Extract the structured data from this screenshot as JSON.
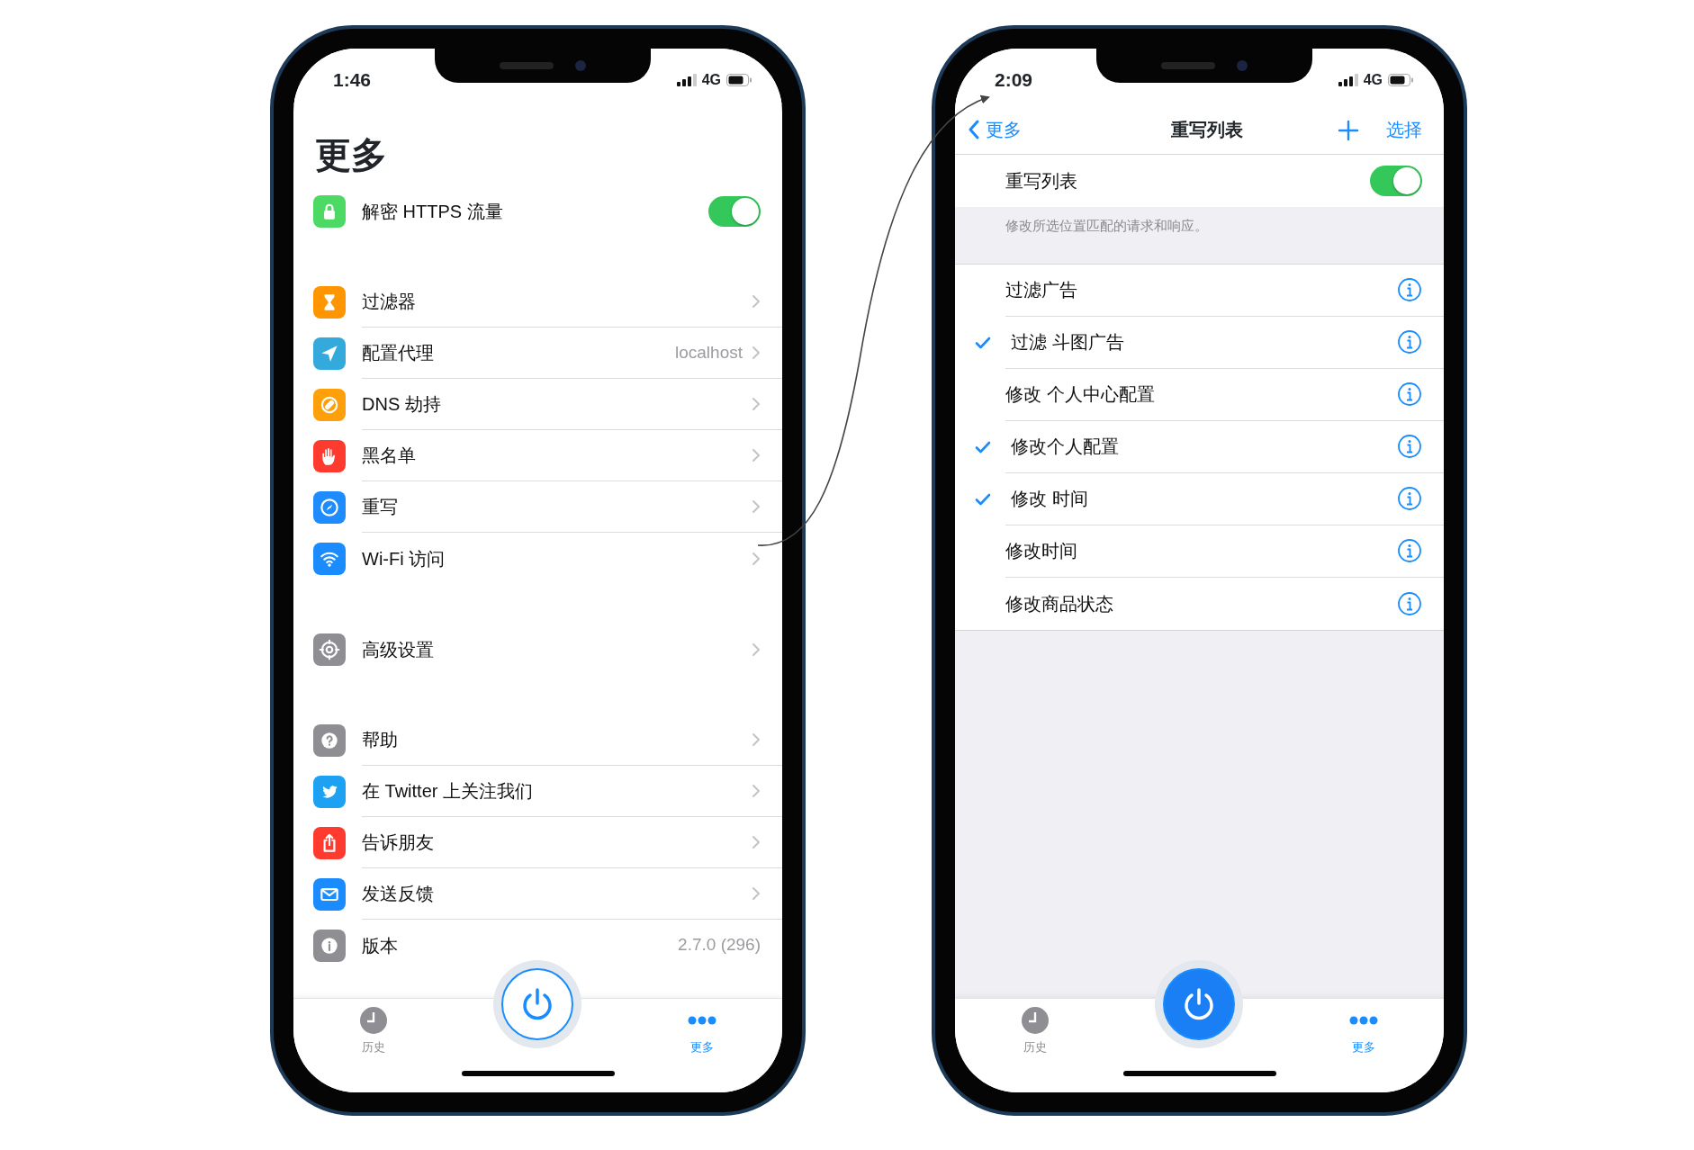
{
  "phones": [
    {
      "status_bar": {
        "time": "1:46",
        "network": "4G"
      },
      "title": "更多",
      "sections": [
        {
          "rows": [
            {
              "kind": "toggle",
              "label": "解密 HTTPS 流量",
              "on": true,
              "color": "#4cd964"
            }
          ]
        },
        {
          "rows": [
            {
              "kind": "link",
              "label": "过滤器",
              "color": "#ff9500"
            },
            {
              "kind": "link",
              "label": "配置代理",
              "detail": "localhost",
              "color": "#34aadc"
            },
            {
              "kind": "link",
              "label": "DNS 劫持",
              "color": "#ff9f0a"
            },
            {
              "kind": "link",
              "label": "黑名单",
              "color": "#ff3b30"
            },
            {
              "kind": "link",
              "label": "重写",
              "color": "#1e8cff"
            },
            {
              "kind": "link",
              "label": "Wi-Fi 访问",
              "color": "#1a8cff"
            }
          ]
        },
        {
          "rows": [
            {
              "kind": "link",
              "label": "高级设置",
              "color": "#8e8e93"
            }
          ]
        },
        {
          "rows": [
            {
              "kind": "link",
              "label": "帮助",
              "color": "#8e8e93"
            },
            {
              "kind": "link",
              "label": "在 Twitter 上关注我们",
              "color": "#1da1f2"
            },
            {
              "kind": "link",
              "label": "告诉朋友",
              "color": "#ff3b30"
            },
            {
              "kind": "link",
              "label": "发送反馈",
              "color": "#1a8cff"
            },
            {
              "kind": "value",
              "label": "版本",
              "detail": "2.7.0 (296)",
              "color": "#8e8e93"
            }
          ]
        }
      ],
      "tabs": [
        {
          "label": "历史",
          "selected": false
        },
        {
          "label": "更多",
          "selected": true
        }
      ],
      "power": {
        "on": false
      }
    },
    {
      "status_bar": {
        "time": "2:09",
        "network": "4G"
      },
      "nav": {
        "back": "更多",
        "title": "重写列表",
        "action": "选择"
      },
      "master_toggle": {
        "label": "重写列表",
        "on": true
      },
      "footer": "修改所选位置匹配的请求和响应。",
      "rules": [
        {
          "label": "过滤广告",
          "checked": false
        },
        {
          "label": "过滤 斗图广告",
          "checked": true
        },
        {
          "label": "修改 个人中心配置",
          "checked": false
        },
        {
          "label": "修改个人配置",
          "checked": true
        },
        {
          "label": "修改 时间",
          "checked": true
        },
        {
          "label": "修改时间",
          "checked": false
        },
        {
          "label": "修改商品状态",
          "checked": false
        }
      ],
      "tabs": [
        {
          "label": "历史",
          "selected": false
        },
        {
          "label": "更多",
          "selected": true
        }
      ],
      "power": {
        "on": true
      }
    }
  ]
}
